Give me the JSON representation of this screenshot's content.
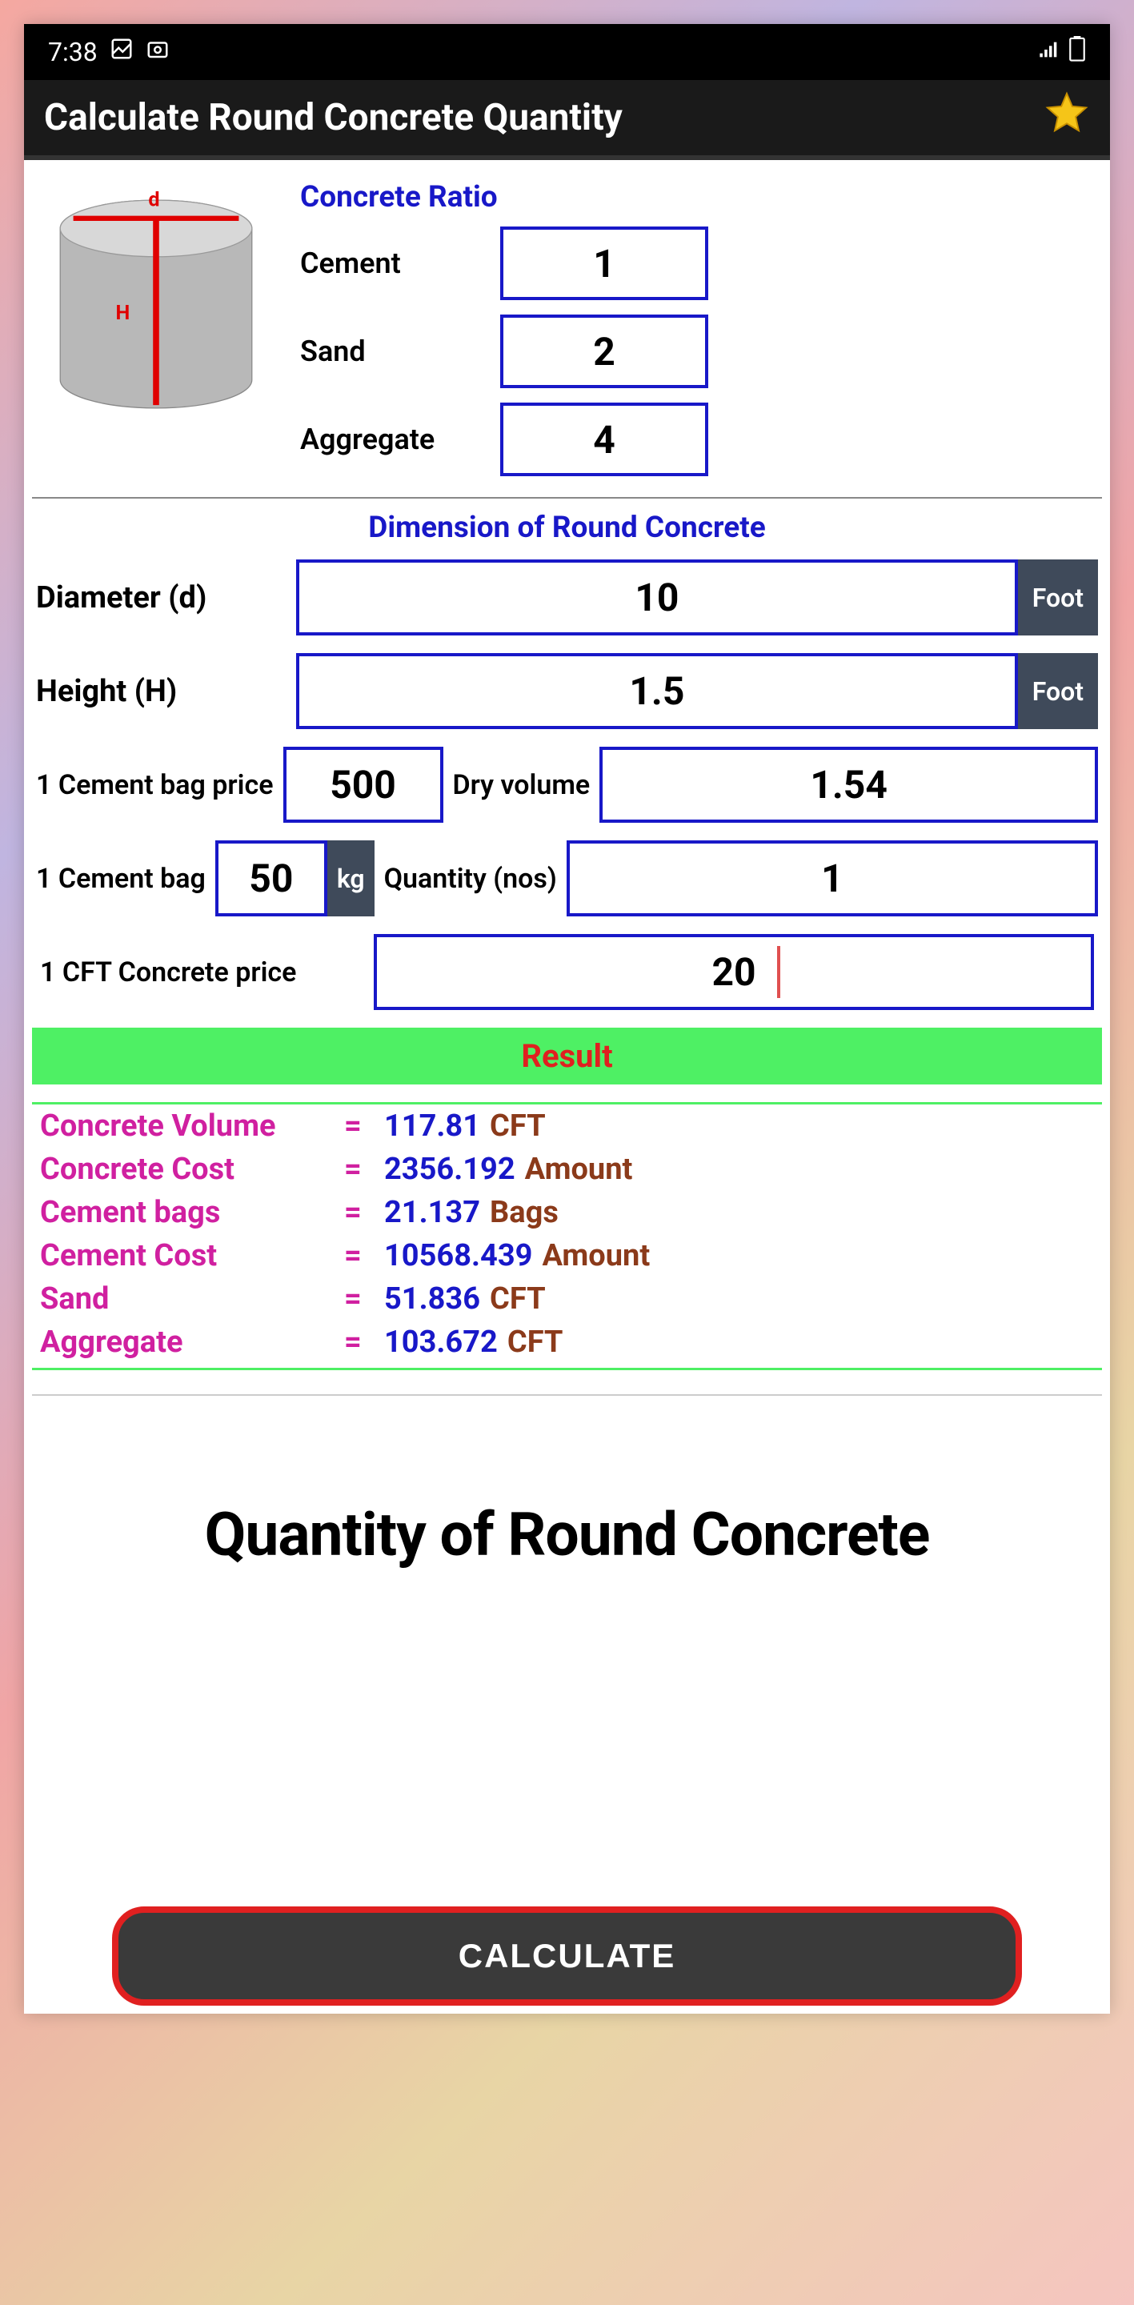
{
  "status": {
    "time": "7:38"
  },
  "app": {
    "title": "Calculate Round Concrete Quantity"
  },
  "ratio": {
    "title": "Concrete Ratio",
    "cement_label": "Cement",
    "cement": "1",
    "sand_label": "Sand",
    "sand": "2",
    "aggregate_label": "Aggregate",
    "aggregate": "4"
  },
  "dimension": {
    "title": "Dimension of Round Concrete",
    "diameter_label": "Diameter (d)",
    "diameter": "10",
    "diameter_unit": "Foot",
    "height_label": "Height (H)",
    "height": "1.5",
    "height_unit": "Foot"
  },
  "extras": {
    "bag_price_label": "1 Cement bag price",
    "bag_price": "500",
    "dry_vol_label": "Dry volume",
    "dry_vol": "1.54",
    "bag_weight_label": "1 Cement bag",
    "bag_weight": "50",
    "bag_weight_unit": "kg",
    "qty_label": "Quantity (nos)",
    "qty": "1",
    "cft_price_label": "1 CFT Concrete price",
    "cft_price": "20"
  },
  "result": {
    "header": "Result",
    "volume_label": "Concrete Volume",
    "volume": "117.81",
    "volume_unit": "CFT",
    "cost_label": "Concrete Cost",
    "cost": "2356.192",
    "cost_unit": "Amount",
    "bags_label": "Cement bags",
    "bags": "21.137",
    "bags_unit": "Bags",
    "cement_cost_label": "Cement Cost",
    "cement_cost": "10568.439",
    "cement_cost_unit": "Amount",
    "sand_label": "Sand",
    "sand": "51.836",
    "sand_unit": "CFT",
    "agg_label": "Aggregate",
    "agg": "103.672",
    "agg_unit": "CFT"
  },
  "big_title": "Quantity of Round Concrete",
  "calc_button": "CALCULATE"
}
